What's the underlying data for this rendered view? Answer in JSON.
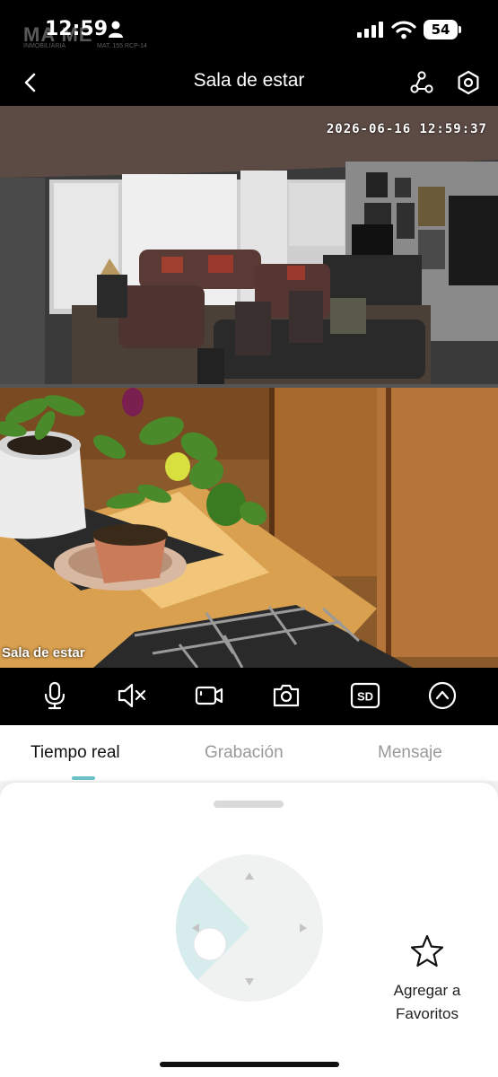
{
  "status_bar": {
    "time": "12:59",
    "battery": "54",
    "watermark": "MA  ME",
    "watermark_sub": "INMOBILIARIA",
    "watermark_sub2": "MAT. 155 RCP-14"
  },
  "header": {
    "title": "Sala de estar",
    "icons": [
      "back-chevron-icon",
      "share-icon",
      "settings-icon"
    ]
  },
  "feed": {
    "timestamp": "2026-06-16  12:59:37",
    "camera_label": "Sala de estar"
  },
  "controls": {
    "sd_label": "SD",
    "icons": [
      "microphone-icon",
      "speaker-muted-icon",
      "record-video-icon",
      "camera-snapshot-icon",
      "sd-quality-icon",
      "chevron-up-circle-icon"
    ]
  },
  "tabs": [
    {
      "label": "Tiempo real",
      "active": true
    },
    {
      "label": "Grabación",
      "active": false
    },
    {
      "label": "Mensaje",
      "active": false
    }
  ],
  "favorites": {
    "line1": "Agregar a",
    "line2": "Favoritos"
  },
  "colors": {
    "accent": "#6cc4c8",
    "background": "#000000"
  }
}
